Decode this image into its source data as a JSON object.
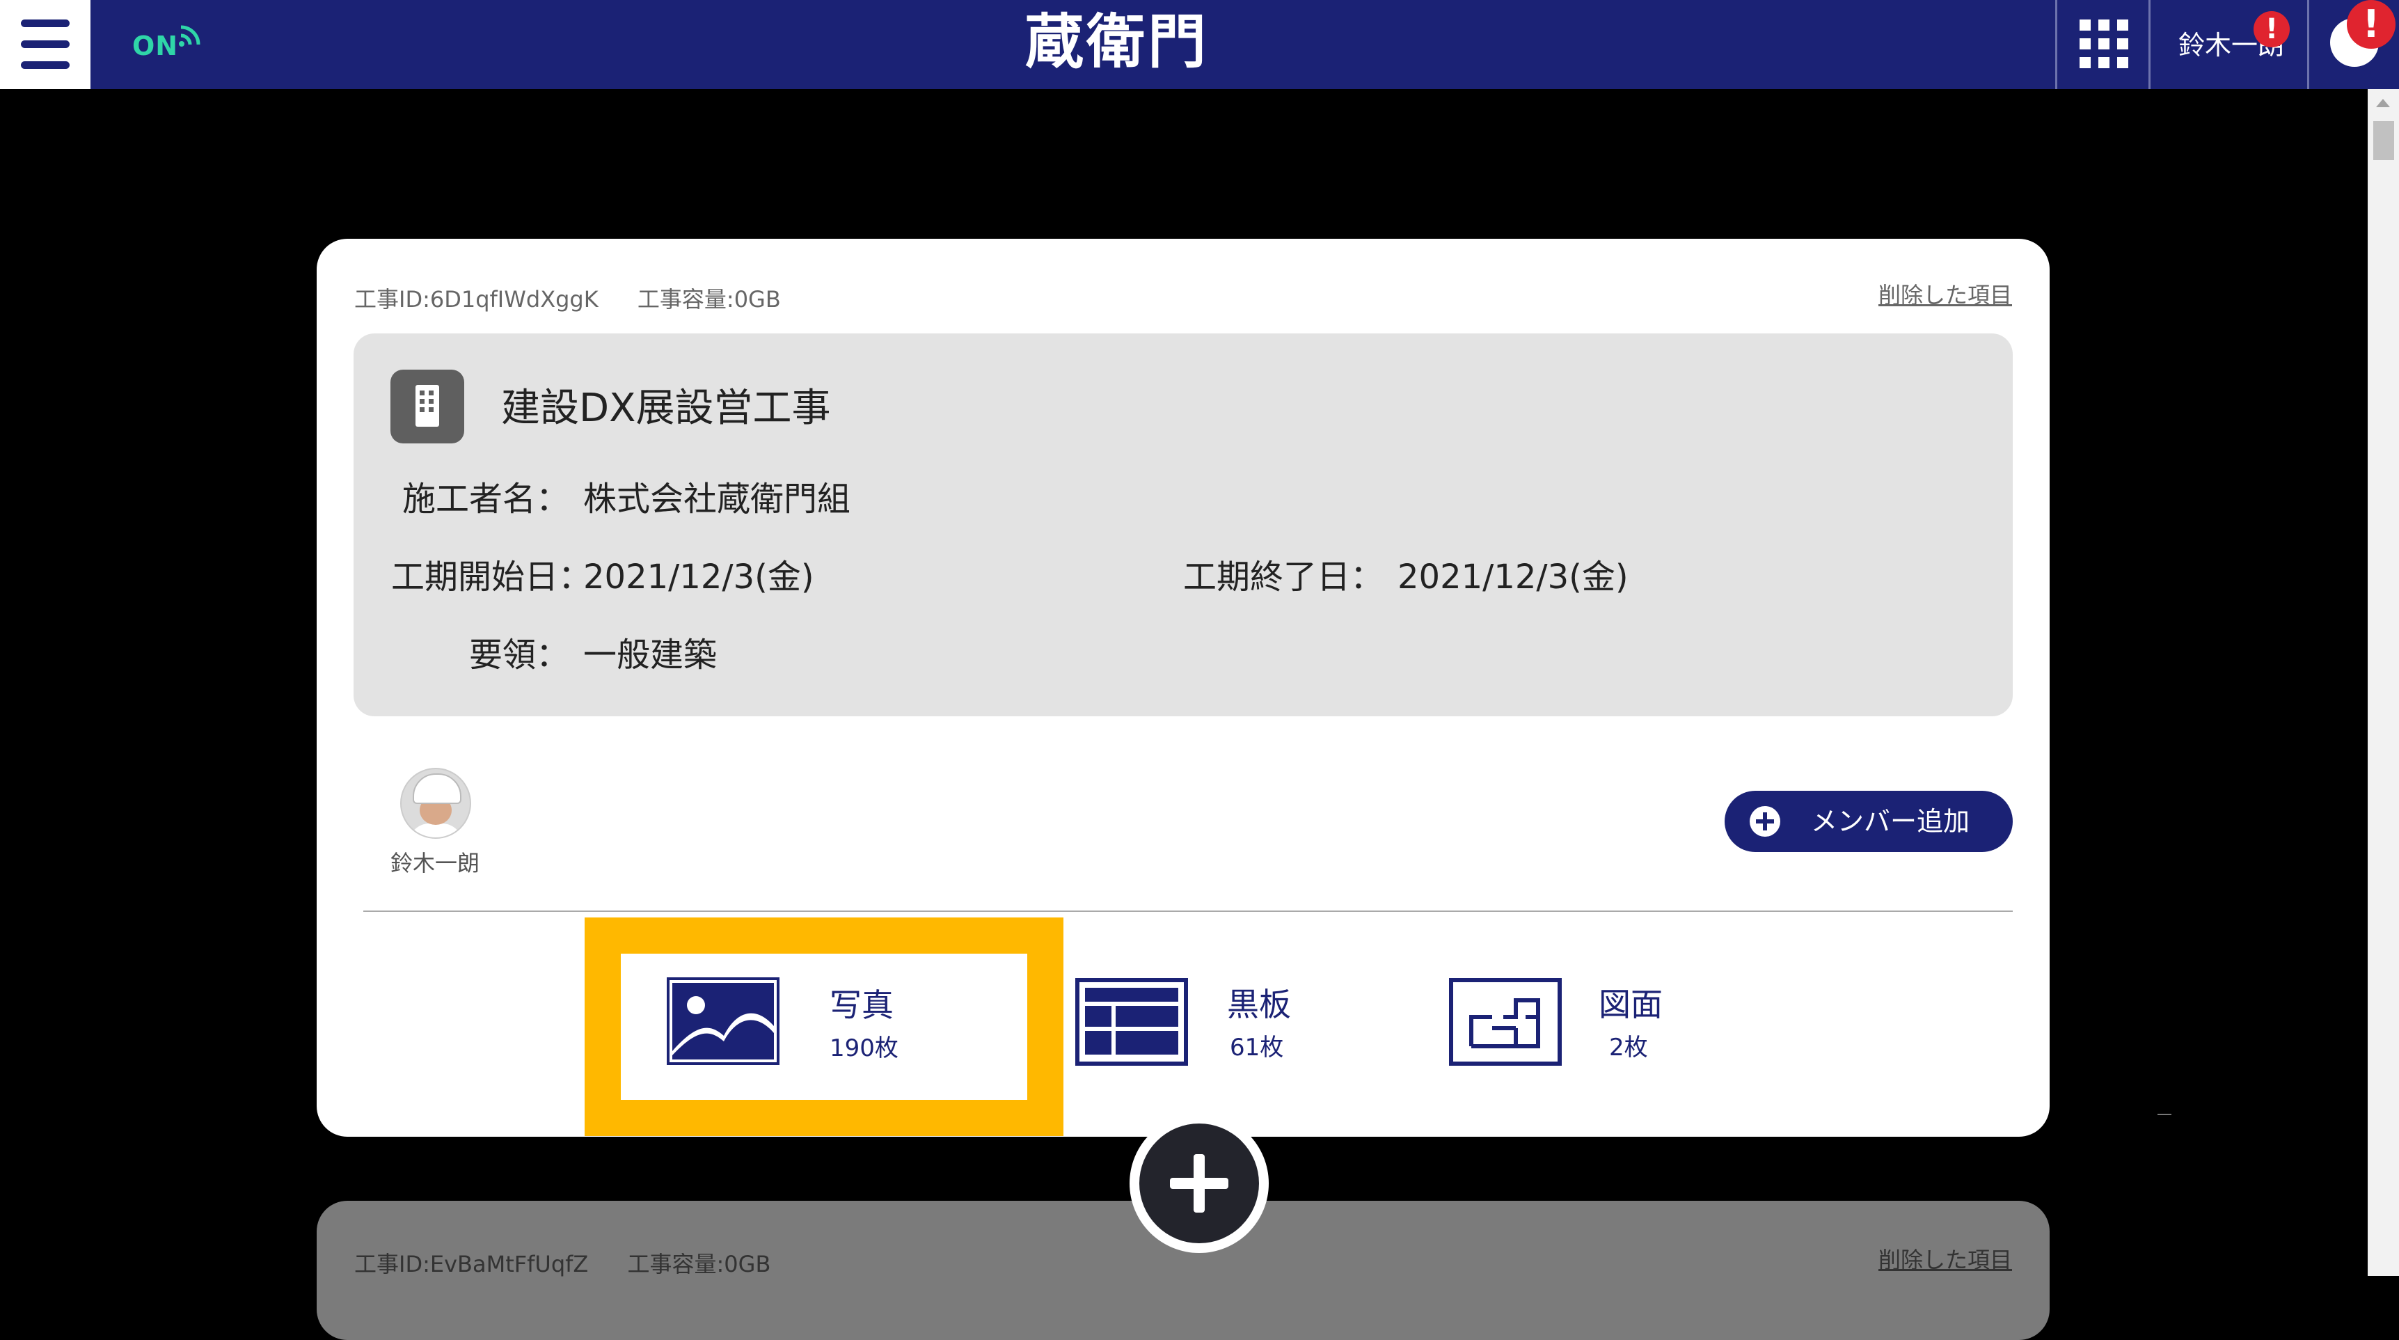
{
  "topbar": {
    "online_status": "ON",
    "logo": "蔵衛門",
    "user_name": "鈴木一朗",
    "user_alert": "!",
    "notify_alert": "!"
  },
  "project": {
    "meta_id": "工事ID:6D1qfIWdXggK",
    "meta_capacity": "工事容量:0GB",
    "deleted_link": "削除した項目",
    "title": "建設DX展設営工事",
    "contractor_label": "施工者名：",
    "contractor_value": "株式会社蔵衛門組",
    "start_label": "工期開始日：",
    "start_value": "2021/12/3(金)",
    "end_label": "工期終了日：",
    "end_value": "2021/12/3(金)",
    "guideline_label": "要領：",
    "guideline_value": "一般建築",
    "members": [
      {
        "name": "鈴木一朗"
      }
    ],
    "add_member_label": "メンバー追加",
    "tabs": [
      {
        "title": "写真",
        "count": "190枚",
        "icon": "photo-icon"
      },
      {
        "title": "黒板",
        "count": "61枚",
        "icon": "blackboard-icon"
      },
      {
        "title": "図面",
        "count": "2枚",
        "icon": "floor-plan-icon"
      }
    ]
  },
  "next_project": {
    "meta_id": "工事ID:EvBaMtFfUqfZ",
    "meta_capacity": "工事容量:0GB",
    "deleted_link": "削除した項目"
  },
  "colors": {
    "brand": "#1b2275",
    "highlight": "#ffb800",
    "online": "#2fd6a8",
    "alert": "#e0242f"
  }
}
